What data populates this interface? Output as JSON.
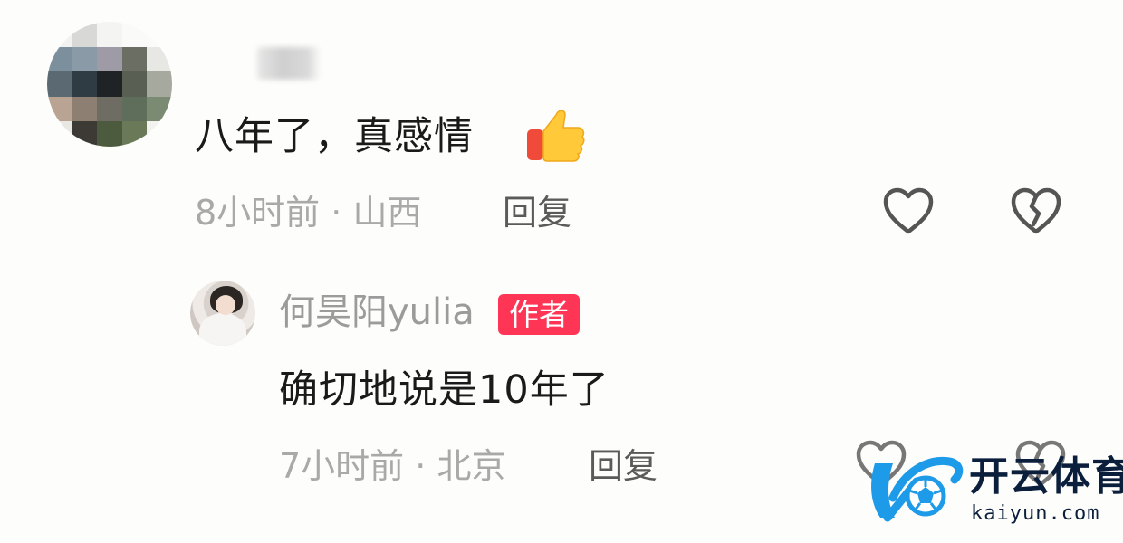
{
  "comments": [
    {
      "text": "八年了，真感情",
      "emoji": "thumbs-up-icon",
      "time": "8小时前",
      "location": "山西",
      "reply_label": "回复"
    },
    {
      "username": "何昊阳yulia",
      "badge": "作者",
      "text": "确切地说是10年了",
      "time": "7小时前",
      "location": "北京",
      "reply_label": "回复"
    }
  ],
  "separator": " · ",
  "watermark": {
    "name": "开云体育",
    "url": "kaiyun.com"
  },
  "colors": {
    "badge_bg": "#ff3556",
    "meta_text": "#a9a9a9",
    "reply_text": "#5a5a5a",
    "watermark_blue": "#1e9be8",
    "watermark_text": "#0b1f3d"
  }
}
